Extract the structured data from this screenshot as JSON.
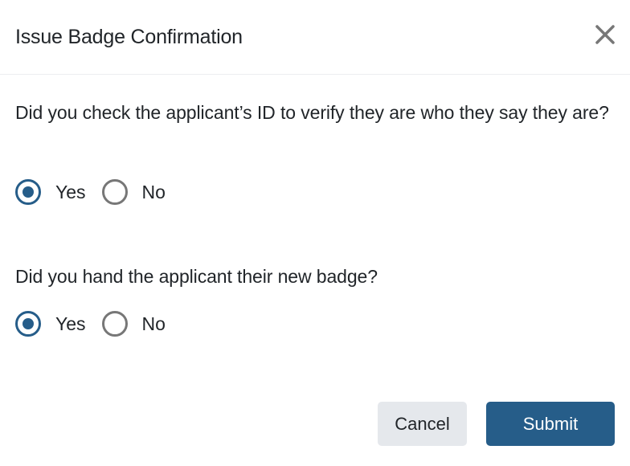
{
  "dialog": {
    "title": "Issue Badge Confirmation",
    "close_icon": "close-icon"
  },
  "questions": [
    {
      "text": "Did you check the applicant’s ID to verify they are who they say they are?",
      "options": [
        {
          "label": "Yes",
          "checked": true
        },
        {
          "label": "No",
          "checked": false
        }
      ]
    },
    {
      "text": "Did you hand the applicant their new badge?",
      "options": [
        {
          "label": "Yes",
          "checked": true
        },
        {
          "label": "No",
          "checked": false
        }
      ]
    }
  ],
  "footer": {
    "cancel_label": "Cancel",
    "submit_label": "Submit"
  },
  "colors": {
    "accent": "#265d89",
    "cancel_bg": "#e5e8ec",
    "text": "#212529"
  }
}
